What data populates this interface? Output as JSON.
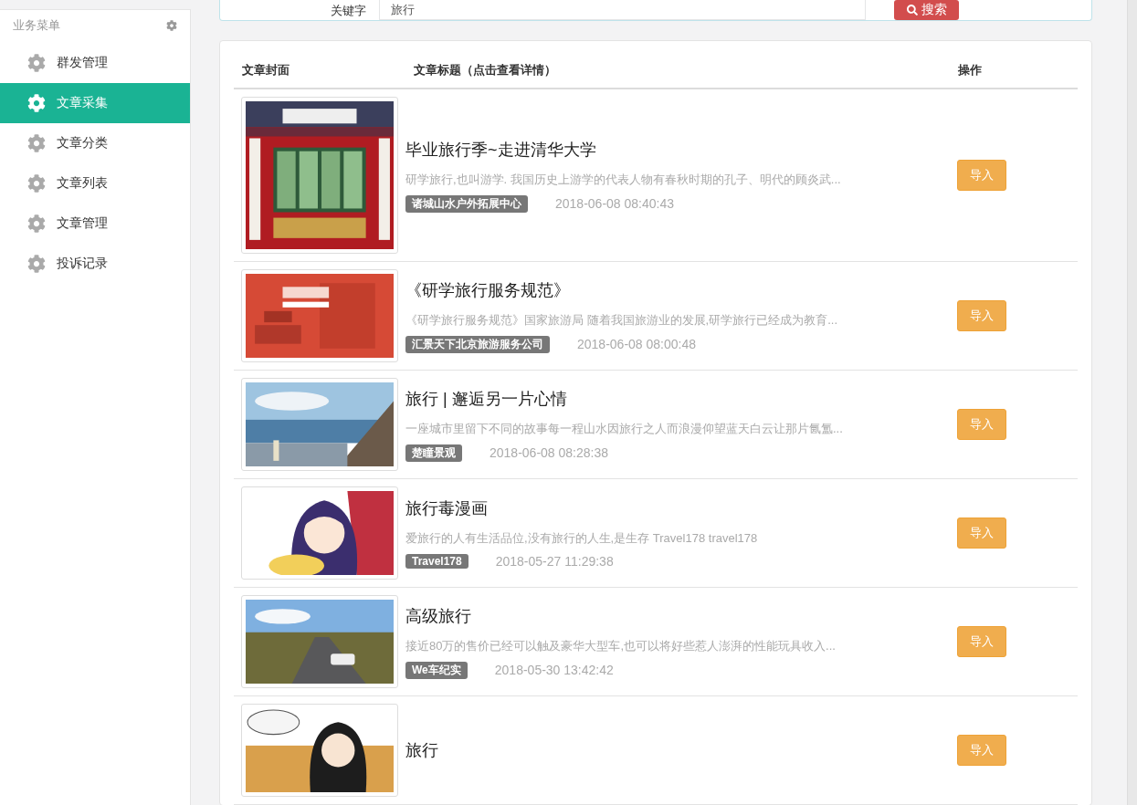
{
  "sidebar": {
    "title": "业务菜单",
    "items": [
      {
        "label": "群发管理",
        "selected": false
      },
      {
        "label": "文章采集",
        "selected": true
      },
      {
        "label": "文章分类",
        "selected": false
      },
      {
        "label": "文章列表",
        "selected": false
      },
      {
        "label": "文章管理",
        "selected": false
      },
      {
        "label": "投诉记录",
        "selected": false
      }
    ]
  },
  "search": {
    "label": "关键字",
    "value": "旅行",
    "button": "搜索"
  },
  "table": {
    "columns": [
      "文章封面",
      "文章标题（点击查看详情）",
      "操作"
    ],
    "rows": [
      {
        "title": "毕业旅行季~走进清华大学",
        "summary": "研学旅行,也叫游学. 我国历史上游学的代表人物有春秋时期的孔子、明代的顾炎武...",
        "source": "诸城山水户外拓展中心",
        "date": "2018-06-08 08:40:43",
        "action": "导入"
      },
      {
        "title": "《研学旅行服务规范》",
        "summary": "《研学旅行服务规范》国家旅游局 随着我国旅游业的发展,研学旅行已经成为教育...",
        "source": "汇景天下北京旅游服务公司",
        "date": "2018-06-08 08:00:48",
        "action": "导入"
      },
      {
        "title": "旅行 | 邂逅另一片心情",
        "summary": "一座城市里留下不同的故事每一程山水因旅行之人而浪漫仰望蓝天白云让那片氤氲...",
        "source": "楚瞳景观",
        "date": "2018-06-08 08:28:38",
        "action": "导入"
      },
      {
        "title": "旅行毒漫画",
        "summary": "爱旅行的人有生活品位,没有旅行的人生,是生存 Travel178 travel178",
        "source": "Travel178",
        "date": "2018-05-27 11:29:38",
        "action": "导入"
      },
      {
        "title": "高级旅行",
        "summary": "接近80万的售价已经可以触及豪华大型车,也可以将好些惹人澎湃的性能玩具收入...",
        "source": "We车纪实",
        "date": "2018-05-30 13:42:42",
        "action": "导入"
      },
      {
        "title": "旅行",
        "action": "导入"
      }
    ]
  }
}
